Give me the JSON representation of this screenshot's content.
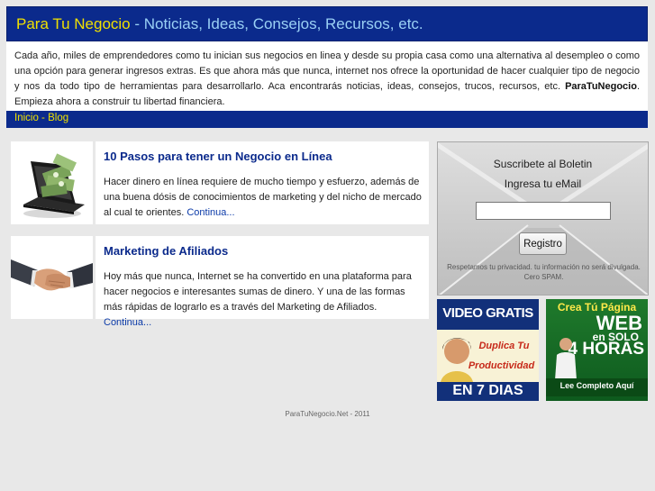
{
  "header": {
    "brand": "Para Tu Negocio",
    "subtitle": " - Noticias, Ideas, Consejos, Recursos, etc."
  },
  "intro": {
    "text": "Cada año, miles de emprendedores como tu inician sus negocios en linea y desde su propia casa como una alternativa al desempleo o como una opción para generar ingresos extras. Es que ahora más que nunca, internet nos ofrece la oportunidad de hacer cualquier tipo de negocio y nos da todo tipo de herramientas para desarrollarlo. Aca encontrarás noticias, ideas, consejos, trucos, recursos, etc. ",
    "brand": "ParaTuNegocio",
    "tail": ". Empieza ahora a construir tu libertad financiera."
  },
  "nav": {
    "home": "Inicio",
    "sep": " - ",
    "blog": "Blog"
  },
  "posts": [
    {
      "title": "10 Pasos para tener un Negocio en Línea",
      "body": "Hacer dinero en línea requiere de mucho tiempo y esfuerzo, además de una buena dósis de conocimientos de marketing y del nicho de mercado al cual te orientes. ",
      "more": "Continua...",
      "image": "laptop-with-money-icon"
    },
    {
      "title": "Marketing de Afiliados",
      "body": "Hoy más que nunca, Internet se ha convertido en una plataforma para hacer negocios e interesantes sumas de dinero. Y una de las formas más rápidas de lograrlo es a través del Marketing de Afiliados. ",
      "more": "Continua...",
      "image": "handshake-icon"
    }
  ],
  "signup": {
    "title": "Suscribete al Boletin",
    "email_label": "Ingresa tu eMail",
    "email_value": "",
    "button": "Registro",
    "note": "Respetamos tu privacidad. tu información no será divulgada. Cero SPAM."
  },
  "ads": {
    "left": {
      "line1": "VIDEO GRATIS",
      "line2": "Duplica Tu",
      "line3": "Productividad",
      "line4": "EN 7 DIAS"
    },
    "right": {
      "line1": "Crea Tú Página",
      "line2": "WEB",
      "line3": "en SOLO",
      "line4": "4 HORAS",
      "line5": "Lee Completo Aquí"
    }
  },
  "footer": {
    "text": "ParaTuNegocio.Net - 2011"
  },
  "colors": {
    "header_bg": "#0b2a8c",
    "brand": "#f0e000",
    "subtitle": "#9ad0f5",
    "post_title": "#0b2a8c"
  }
}
